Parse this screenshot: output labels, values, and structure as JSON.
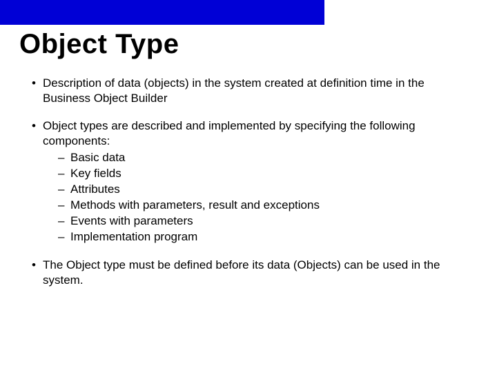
{
  "title": "Object Type",
  "bullets": [
    {
      "text": "Description of data (objects) in the system created at definition time in the Business Object Builder"
    },
    {
      "text": "Object types are described and implemented by specifying the following components:",
      "sub": [
        "Basic data",
        "Key fields",
        "Attributes",
        "Methods with parameters, result and exceptions",
        "Events with parameters",
        "Implementation program"
      ]
    },
    {
      "text": "The Object type must be defined before its data (Objects) can be used in the system."
    }
  ]
}
